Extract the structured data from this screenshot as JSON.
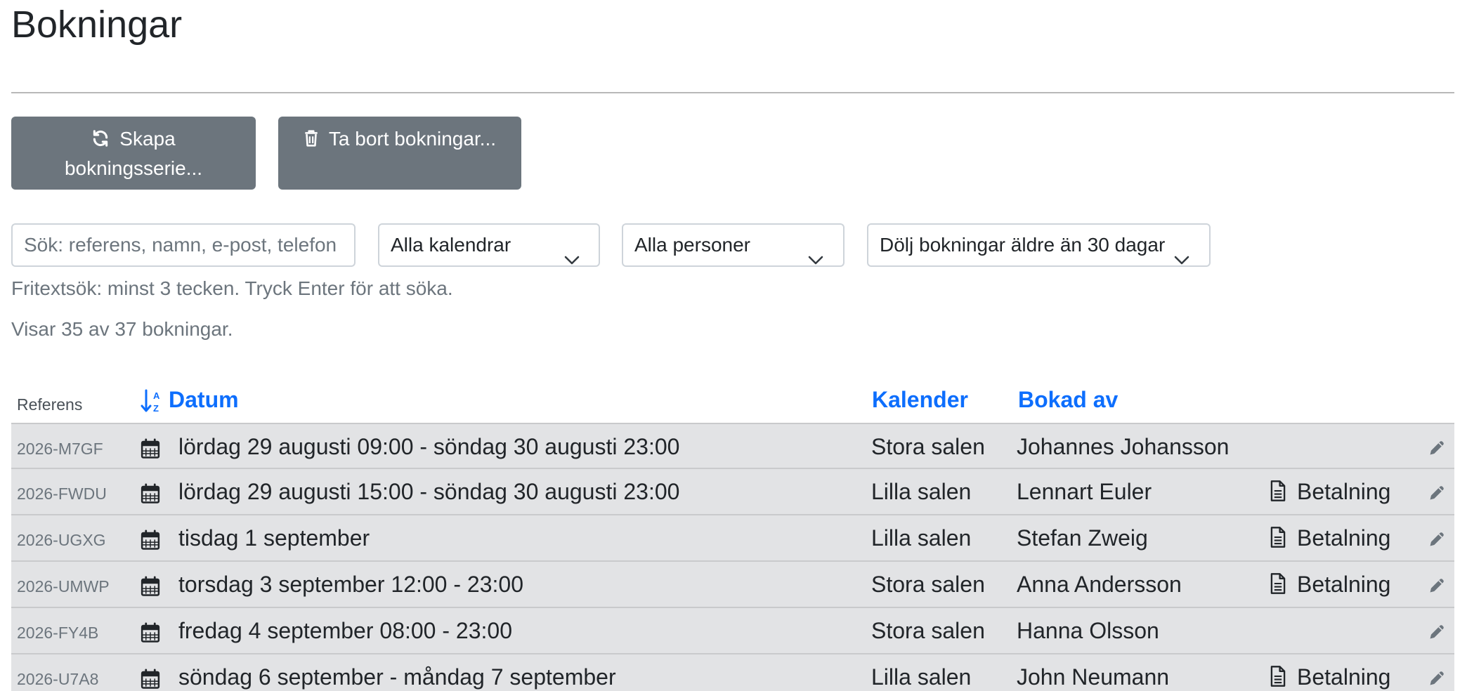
{
  "page": {
    "title": "Bokningar"
  },
  "toolbar": {
    "create_series_line1": "Skapa",
    "create_series_line2": "bokningsserie...",
    "delete_label": "Ta bort bokningar..."
  },
  "filters": {
    "search_placeholder": "Sök: referens, namn, e-post, telefon",
    "calendar_selected": "Alla kalendrar",
    "person_selected": "Alla personer",
    "age_selected": "Dölj bokningar äldre än 30 dagar",
    "help_text": "Fritextsök: minst 3 tecken. Tryck Enter för att söka.",
    "count_text": "Visar 35 av 37 bokningar."
  },
  "table": {
    "headers": {
      "ref": "Referens",
      "date": "Datum",
      "calendar": "Kalender",
      "booked_by": "Bokad av"
    },
    "rows": [
      {
        "ref": "2026-M7GF",
        "date": "lördag 29 augusti 09:00 - söndag 30 augusti 23:00",
        "calendar": "Stora salen",
        "booked_by": "Johannes Johansson",
        "payment": ""
      },
      {
        "ref": "2026-FWDU",
        "date": "lördag 29 augusti 15:00 - söndag 30 augusti 23:00",
        "calendar": "Lilla salen",
        "booked_by": "Lennart Euler",
        "payment": "Betalning"
      },
      {
        "ref": "2026-UGXG",
        "date": "tisdag 1 september",
        "calendar": "Lilla salen",
        "booked_by": "Stefan Zweig",
        "payment": "Betalning"
      },
      {
        "ref": "2026-UMWP",
        "date": "torsdag 3 september 12:00 - 23:00",
        "calendar": "Stora salen",
        "booked_by": "Anna Andersson",
        "payment": "Betalning"
      },
      {
        "ref": "2026-FY4B",
        "date": "fredag 4 september 08:00 - 23:00",
        "calendar": "Stora salen",
        "booked_by": "Hanna Olsson",
        "payment": ""
      },
      {
        "ref": "2026-U7A8",
        "date": "söndag 6 september - måndag 7 september",
        "calendar": "Lilla salen",
        "booked_by": "John Neumann",
        "payment": "Betalning"
      }
    ]
  },
  "icons": {
    "refresh": "refresh-icon",
    "trash": "trash-icon",
    "chevron": "chevron-down-icon",
    "sort": "sort-alpha-down-icon",
    "calendar": "calendar-icon",
    "document": "document-icon",
    "edit": "pencil-icon"
  },
  "colors": {
    "button_bg": "#6c757d",
    "link": "#0d6efd",
    "row_bg": "#e2e3e5",
    "muted_text": "#6c757d"
  }
}
